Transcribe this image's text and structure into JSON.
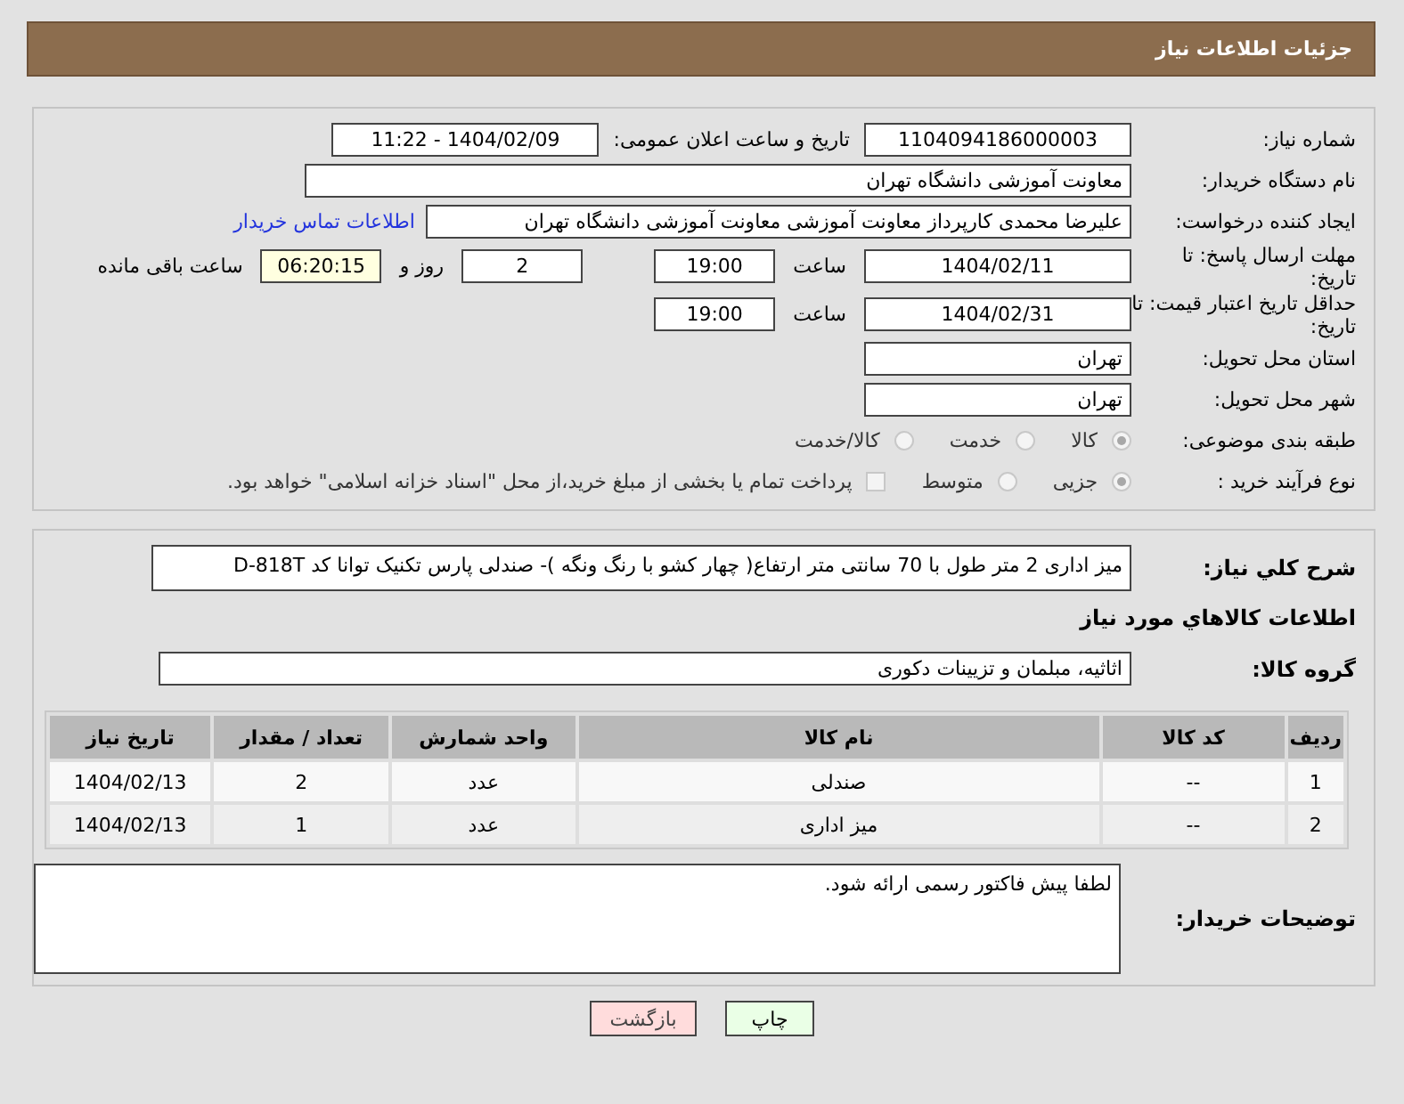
{
  "header": {
    "title": "جزئیات اطلاعات نیاز"
  },
  "need_number": {
    "label": "شماره نیاز:",
    "value": "1104094186000003"
  },
  "announce": {
    "label": "تاریخ و ساعت اعلان عمومی:",
    "value": "1404/02/09 - 11:22"
  },
  "buyer_org": {
    "label": "نام دستگاه خریدار:",
    "value": "معاونت آموزشی دانشگاه تهران"
  },
  "requester": {
    "label": "ایجاد کننده درخواست:",
    "value": "علیرضا محمدی کارپرداز معاونت آموزشی معاونت آموزشی دانشگاه تهران",
    "contact_link": "اطلاعات تماس خریدار"
  },
  "reply_deadline": {
    "label": "مهلت ارسال پاسخ: تا تاریخ:",
    "date": "1404/02/11",
    "time_label": "ساعت",
    "time": "19:00",
    "days": "2",
    "days_label": "روز و",
    "remaining": "06:20:15",
    "remaining_label": "ساعت باقی مانده"
  },
  "price_validity": {
    "label": "حداقل تاریخ اعتبار قیمت: تا تاریخ:",
    "date": "1404/02/31",
    "time_label": "ساعت",
    "time": "19:00"
  },
  "province": {
    "label": "استان محل تحویل:",
    "value": "تهران"
  },
  "city": {
    "label": "شهر محل تحویل:",
    "value": "تهران"
  },
  "category": {
    "label": "طبقه بندی موضوعی:",
    "options": [
      {
        "label": "کالا",
        "selected": true
      },
      {
        "label": "خدمت",
        "selected": false
      },
      {
        "label": "کالا/خدمت",
        "selected": false
      }
    ]
  },
  "purchase_type": {
    "label": "نوع فرآیند خرید :",
    "options": [
      {
        "label": "جزیی",
        "selected": true
      },
      {
        "label": "متوسط",
        "selected": false
      }
    ],
    "treasury": {
      "label": "پرداخت تمام یا بخشی از مبلغ خرید،از محل \"اسناد خزانه اسلامی\" خواهد بود.",
      "checked": false
    }
  },
  "description": {
    "label": "شرح کلي نياز:",
    "value": "میز اداری 2 متر طول با 70 سانتی متر ارتفاع( چهار کشو با رنگ ونگه )- صندلی پارس تکنیک توانا کد D-818T"
  },
  "goods_section": {
    "title": "اطلاعات کالاهاي مورد نياز"
  },
  "goods_group": {
    "label": "گروه کالا:",
    "value": "اثاثیه، مبلمان و تزیینات دکوری"
  },
  "table": {
    "columns": [
      "ردیف",
      "کد کالا",
      "نام کالا",
      "واحد شمارش",
      "تعداد / مقدار",
      "تاریخ نیاز"
    ],
    "rows": [
      [
        "1",
        "--",
        "صندلی",
        "عدد",
        "2",
        "1404/02/13"
      ],
      [
        "2",
        "--",
        "میز اداری",
        "عدد",
        "1",
        "1404/02/13"
      ]
    ]
  },
  "buyer_notes": {
    "label": "توضیحات خریدار:",
    "value": "لطفا پیش فاکتور رسمی ارائه شود."
  },
  "buttons": [
    {
      "label": "چاپ",
      "kind": "print"
    },
    {
      "label": "بازگشت",
      "kind": "back"
    }
  ]
}
